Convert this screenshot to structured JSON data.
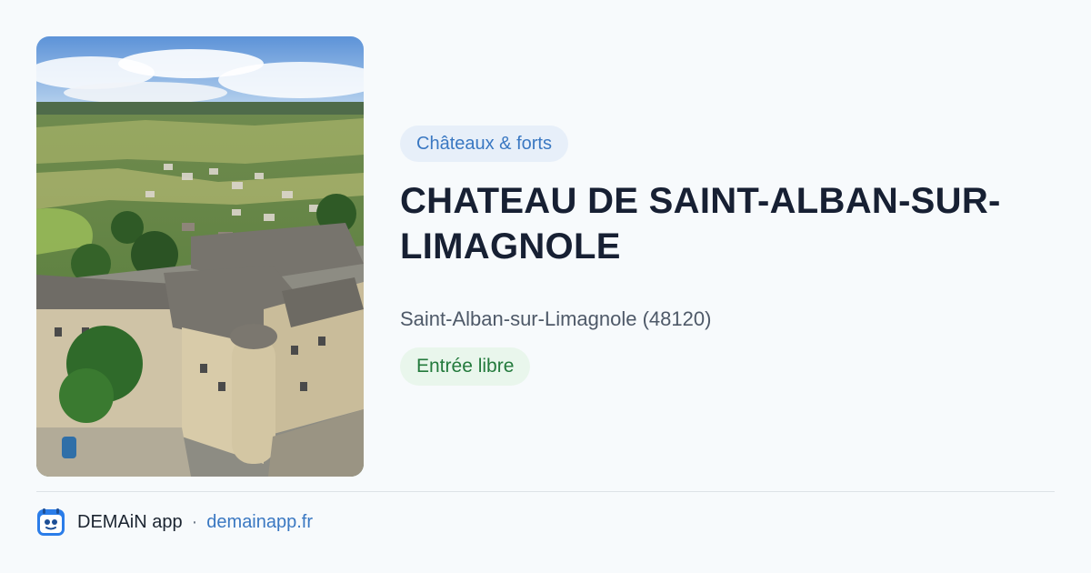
{
  "place": {
    "photo": "aerial photo of the castle and village",
    "category": "Châteaux & forts",
    "title": "CHATEAU DE SAINT-ALBAN-SUR-LIMAGNOLE",
    "location": "Saint-Alban-sur-Limagnole (48120)",
    "access": "Entrée libre"
  },
  "footer": {
    "logo_icon": "demain-app-logo-icon",
    "app_name": "DEMAiN app",
    "separator": "·",
    "site": "demainapp.fr"
  },
  "colors": {
    "background": "#f7fafc",
    "category_bg": "#e7eff9",
    "category_text": "#3a78c2",
    "access_bg": "#e9f6ec",
    "access_text": "#237a3c",
    "title": "#172033",
    "link": "#3a78c2"
  }
}
